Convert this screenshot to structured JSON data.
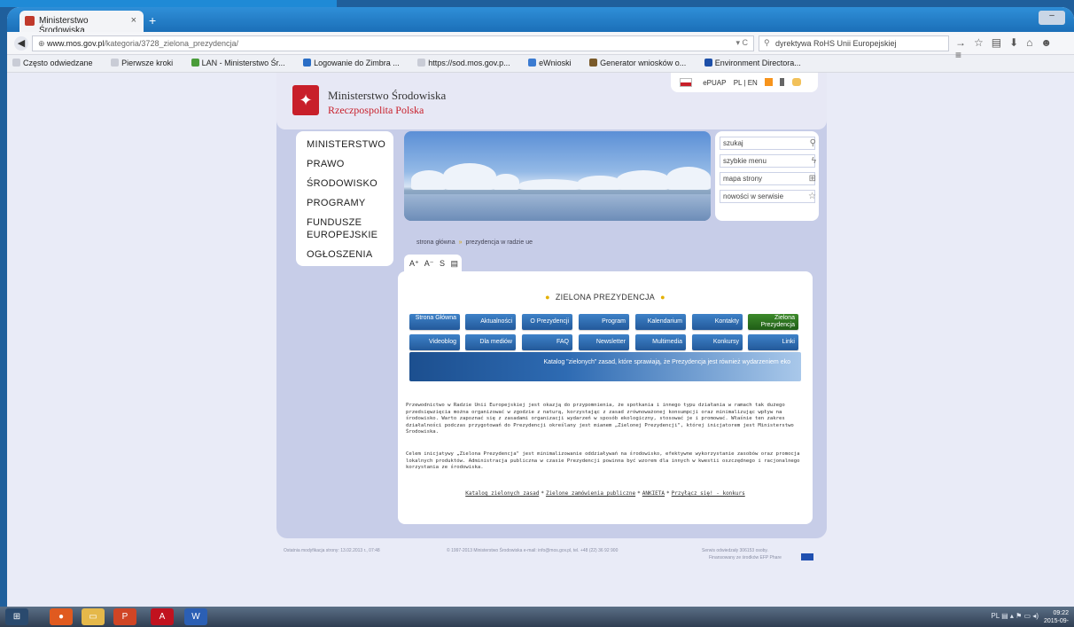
{
  "browser": {
    "tab_title": "Ministerstwo Środowiska",
    "tab_close": "×",
    "new_tab": "+",
    "url_host": "www.mos.gov.pl",
    "url_path": "/kategoria/3728_zielona_prezydencja/",
    "search_text": "dyrektywa RoHS Unii Europejskiej",
    "bookmarks": [
      "Często odwiedzane",
      "Pierwsze kroki",
      "LAN - Ministerstwo Śr...",
      "Logowanie do Zimbra ...",
      "https://sod.mos.gov.p...",
      "eWnioski",
      "Generator wniosków o...",
      "Environment Directora..."
    ]
  },
  "header": {
    "ministry": "Ministerstwo Środowiska",
    "republic": "Rzeczpospolita Polska",
    "epuap": "ePUAP",
    "lang": "PL | EN"
  },
  "menu": [
    "MINISTERSTWO",
    "PRAWO",
    "ŚRODOWISKO",
    "PROGRAMY",
    "FUNDUSZE EUROPEJSKIE",
    "OGŁOSZENIA"
  ],
  "search": {
    "search_label": "szukaj",
    "quick_menu": "szybkie menu",
    "sitemap": "mapa strony",
    "news": "nowości w serwisie"
  },
  "breadcrumb": {
    "home": "strona główna",
    "current": "prezydencja w radzie ue"
  },
  "font_controls": "A⁺ A⁻ S",
  "zp": {
    "title": "ZIELONA PREZYDENCJA",
    "buttons_row1": [
      "Strona Główna",
      "Aktualności",
      "O Prezydencji",
      "Program",
      "Kalendarium",
      "Kontakty",
      "Zielona Prezydencja"
    ],
    "buttons_row2": [
      "Videoblog",
      "Dla mediów",
      "FAQ",
      "Newsletter",
      "Multimedia",
      "Konkursy",
      "Linki"
    ],
    "catalog": "Katalog \"zielonych\" zasad, które sprawiają, że Prezydencja jest również wydarzeniem eko",
    "para1": "Przewodnictwo w Radzie Unii Europejskiej jest okazją do przypomnienia, że spotkania i innego typu działania w ramach tak dużego przedsięwzięcia można organizować w zgodzie z naturą, korzystając z zasad zrównoważonej konsumpcji oraz minimalizując wpływ na środowisko. Warto zapoznać się z zasadami organizacji wydarzeń w sposób ekologiczny, stosować je i promować. Właśnie ten zakres działalności podczas przygotowań do Prezydencji określany jest mianem „Zielonej Prezydencji\", której inicjatorem jest Ministerstwo Środowiska.",
    "para2": "Celem inicjatywy „Zielona Prezydencja\" jest minimalizowanie oddziaływań na środowisko, efektywne wykorzystanie zasobów oraz promocja lokalnych produktów. Administracja publiczna w czasie Prezydencji powinna być wzorem dla innych w kwestii oszczędnego i racjonalnego korzystania ze środowiska.",
    "links": [
      "Katalog zielonych zasad",
      "Zielone zamówienia publiczne",
      "ANKIETA",
      "Przyłącz się! - konkurs"
    ]
  },
  "footer": {
    "modified": "Ostatnia modyfikacja strony: 13.02.2013 r., 07:48",
    "copyright": "© 1997-2013 Ministerstwo Środowiska e-mail: info@mos.gov.pl, tel. +48 (22) 36 92 900",
    "visits": "Serwis odwiedzały 306153 osoby.",
    "funded": "Finansowany ze środków EFP Phare"
  },
  "taskbar": {
    "tray": "PL",
    "time": "09:22",
    "date": "2015-09-"
  }
}
